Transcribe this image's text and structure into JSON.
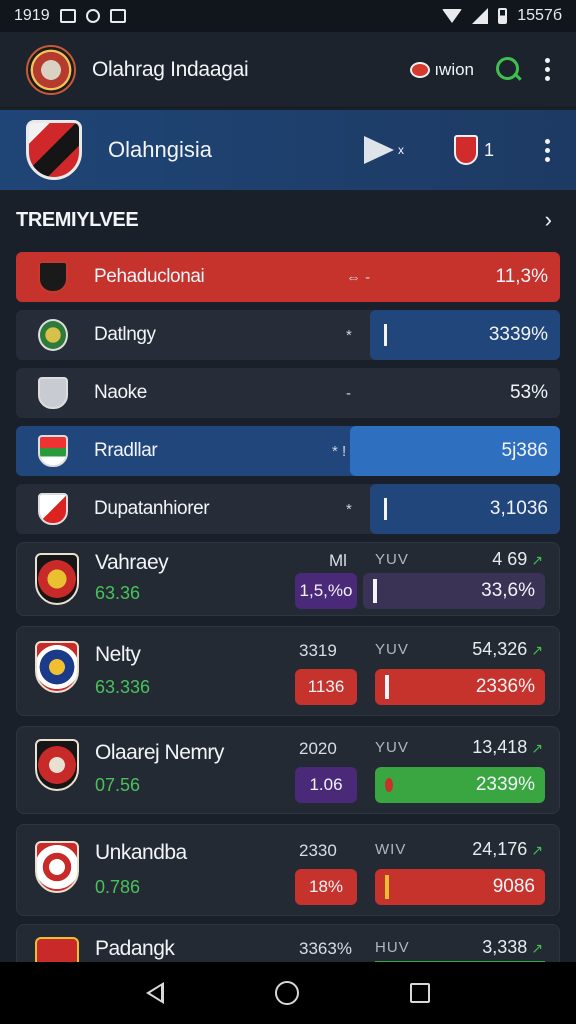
{
  "status_bar": {
    "time": "1919",
    "right_text": "1557б"
  },
  "header": {
    "title": "Olahrag Indaagai",
    "tag_label": "ıwion"
  },
  "featured": {
    "title": "Olahngisia",
    "play_label": "x",
    "shield_count": "1"
  },
  "section": {
    "title": "TRЕMIYLVEE",
    "arrow": "›"
  },
  "rows": [
    {
      "name": "Pehaduclonai",
      "mid": "⇔   -",
      "pct": "11,3%",
      "tick": ""
    },
    {
      "name": "Datlngy",
      "mid": "*",
      "pct": "3339%",
      "tick": "I"
    },
    {
      "name": "Naoke",
      "mid": "-",
      "pct": "53%",
      "tick": ""
    },
    {
      "name": "Rradllar",
      "mid": "* ! -",
      "pct": "5j386",
      "tick": ""
    },
    {
      "name": "Dupatanhiorer",
      "mid": "*",
      "pct": "3,1036",
      "tick": "I"
    }
  ],
  "cards": [
    {
      "name": "Vahraey",
      "sub": "63.36",
      "col1": "Ml",
      "col2": "YUV",
      "col3": "4 69",
      "chip": "1,5,%o",
      "pct": "33,6%"
    },
    {
      "name": "Nelty",
      "sub": "63.336",
      "col1": "3319",
      "col2": "YUV",
      "col3": "54,326",
      "chip": "1136",
      "pct": "2336%"
    },
    {
      "name": "Olaarej Nemry",
      "sub": "07.56",
      "col1": "2020",
      "col2": "YUV",
      "col3": "13,418",
      "chip": "1.06",
      "pct": "2339%"
    },
    {
      "name": "Unkandba",
      "sub": "0.786",
      "col1": "2330",
      "col2": "WIV",
      "col3": "24,176",
      "chip": "18%",
      "pct": "9086"
    },
    {
      "name": "Padangk",
      "sub": "",
      "col1": "3363%",
      "col2": "HUV",
      "col3": "3,338",
      "chip": "",
      "pct": ""
    }
  ],
  "colors": {
    "red": "#c6322c",
    "blue": "#20467c",
    "bright_blue": "#2e6fc0",
    "green": "#3ec04e",
    "purple": "#4a2a78",
    "card_bg": "#232a34"
  }
}
